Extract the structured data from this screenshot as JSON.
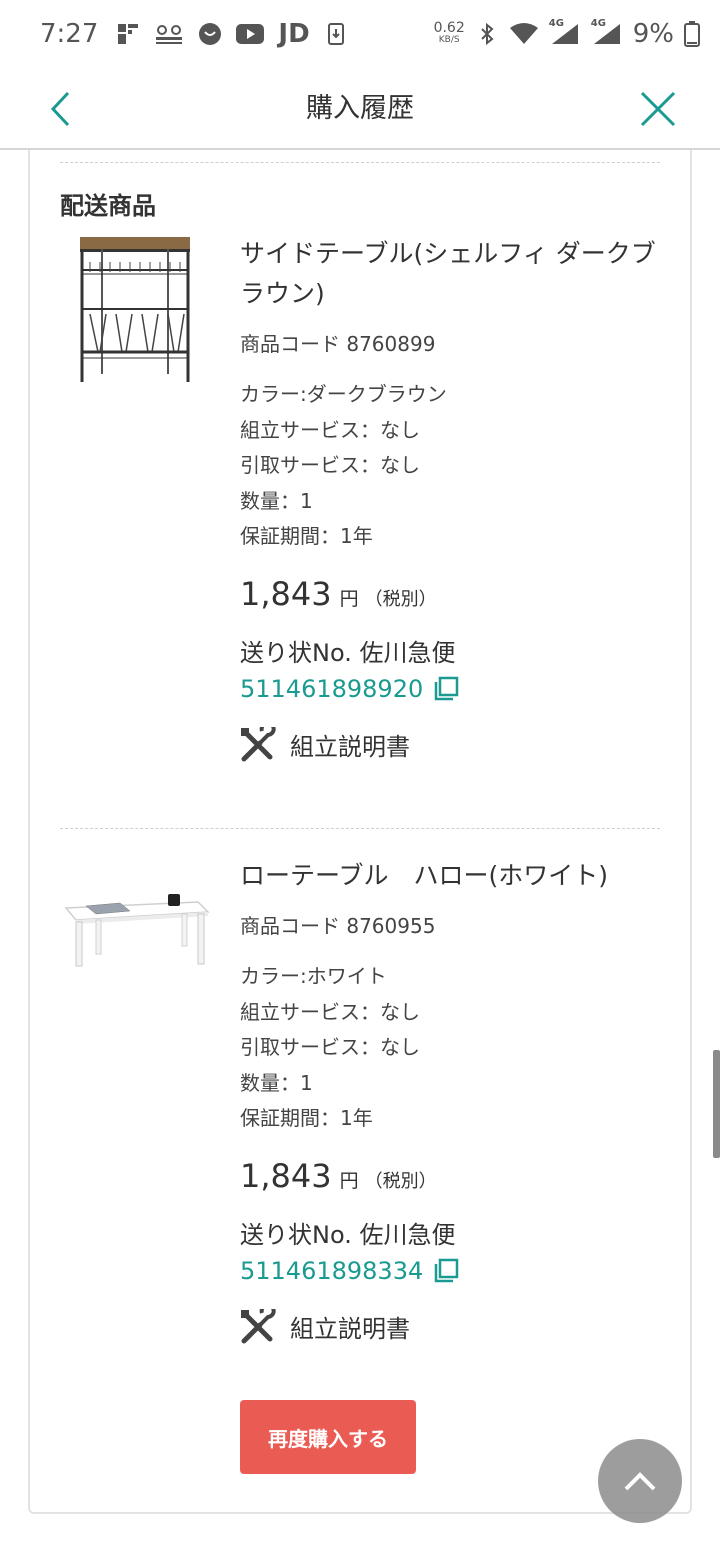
{
  "status_bar": {
    "time": "7:27",
    "app_text": "JD",
    "net_speed_value": "0.62",
    "net_speed_unit": "KB/S",
    "signal1_label": "4G",
    "signal2_label": "4G",
    "battery": "9%",
    "icons": [
      "notification-app-icon",
      "hello-cycling-icon",
      "circle-app-icon",
      "youtube-icon",
      "download-icon",
      "bluetooth-icon",
      "wifi-icon",
      "signal-icon",
      "battery-icon"
    ]
  },
  "header": {
    "title": "購入履歴",
    "accent": "#1a9a90"
  },
  "section": {
    "title": "配送商品"
  },
  "items": [
    {
      "name": "サイドテーブル(シェルフィ ダークブラウン)",
      "code": "商品コード 8760899",
      "attributes": [
        "カラー:ダークブラウン",
        "組立サービス：なし",
        "引取サービス：なし",
        "数量：1",
        "保証期間：1年"
      ],
      "price": "1,843",
      "price_unit": "円",
      "price_tax": "（税別）",
      "shipping_label": "送り状No. 佐川急便",
      "tracking_number": "511461898920",
      "manual_label": "組立説明書"
    },
    {
      "name": "ローテーブル　ハロー(ホワイト)",
      "code": "商品コード 8760955",
      "attributes": [
        "カラー:ホワイト",
        "組立サービス：なし",
        "引取サービス：なし",
        "数量：1",
        "保証期間：1年"
      ],
      "price": "1,843",
      "price_unit": "円",
      "price_tax": "（税別）",
      "shipping_label": "送り状No. 佐川急便",
      "tracking_number": "511461898334",
      "manual_label": "組立説明書"
    }
  ],
  "rebuy_button": {
    "label": "再度購入する",
    "color": "#ea5b54"
  }
}
